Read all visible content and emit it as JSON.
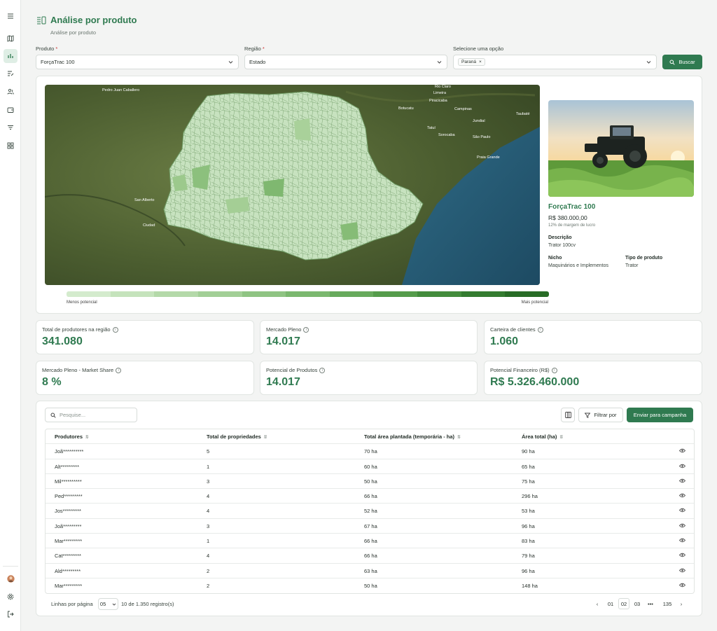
{
  "page": {
    "title": "Análise por produto",
    "subtitle": "Análise por produto"
  },
  "filters": {
    "produto_label": "Produto",
    "produto_value": "ForçaTrac 100",
    "regiao_label": "Região",
    "regiao_value": "Estado",
    "opcao_label": "Selecione uma opção",
    "opcao_chip": "Paraná",
    "search_button": "Buscar",
    "required_mark": "*"
  },
  "map": {
    "cities": [
      "Pedro Juan Caballero",
      "Rio Claro",
      "Limeira",
      "Piracicaba",
      "Botucatu",
      "Campinas",
      "Jundiaí",
      "Taubaté",
      "Tatuí",
      "Sorocaba",
      "São Paulo",
      "Praia Grande",
      "San Alberto",
      "Ciudad"
    ],
    "legend_low": "Menos potencial",
    "legend_high": "Mais potencial",
    "legend_colors": [
      "#d4ebcd",
      "#c5e3bc",
      "#b4d9a9",
      "#a2cf96",
      "#8fc483",
      "#7bb86f",
      "#67aa5c",
      "#559c4b",
      "#438c3c",
      "#347c30",
      "#286c26"
    ]
  },
  "product": {
    "name": "ForçaTrac 100",
    "price": "R$ 380.000,00",
    "margin": "12% de margem de lucro",
    "desc_label": "Descrição",
    "desc_value": "Trator 100cv",
    "nicho_label": "Nicho",
    "nicho_value": "Maquinários e Implementos",
    "tipo_label": "Tipo de produto",
    "tipo_value": "Trator"
  },
  "stats": [
    {
      "label": "Total de produtores na região",
      "value": "341.080"
    },
    {
      "label": "Mercado Pleno",
      "value": "14.017"
    },
    {
      "label": "Carteira de clientes",
      "value": "1.060"
    },
    {
      "label": "Mercado Pleno - Market Share",
      "value": "8 %"
    },
    {
      "label": "Potencial de Produtos",
      "value": "14.017"
    },
    {
      "label": "Potencial Financeiro (R$)",
      "value": "R$ 5.326.460.000"
    }
  ],
  "table": {
    "search_placeholder": "Pesquise...",
    "filter_button": "Filtrar por",
    "campaign_button": "Enviar para campanha",
    "headers": [
      "Produtores",
      "Total de propriedades",
      "Total área plantada (temporária - ha)",
      "Área total (ha)"
    ],
    "rows": [
      [
        "Joã**********",
        "5",
        "70 ha",
        "90 ha"
      ],
      [
        "Alt*********",
        "1",
        "60 ha",
        "65 ha"
      ],
      [
        "Mil**********",
        "3",
        "50 ha",
        "75 ha"
      ],
      [
        "Ped*********",
        "4",
        "66 ha",
        "296 ha"
      ],
      [
        "Jos*********",
        "4",
        "52 ha",
        "53 ha"
      ],
      [
        "Joã*********",
        "3",
        "67 ha",
        "96 ha"
      ],
      [
        "Mar*********",
        "1",
        "66 ha",
        "83 ha"
      ],
      [
        "Cat*********",
        "4",
        "66 ha",
        "79 ha"
      ],
      [
        "Ald*********",
        "2",
        "63 ha",
        "96 ha"
      ],
      [
        "Mar*********",
        "2",
        "50 ha",
        "148 ha"
      ]
    ]
  },
  "pagination": {
    "rows_label": "Linhas por página",
    "rows_value": "05",
    "count_text": "10 de 1.350 registro(s)",
    "pages": [
      "01",
      "02",
      "03",
      "•••",
      "135"
    ],
    "current": "02"
  },
  "colors": {
    "accent": "#2f7a50",
    "accent_light": "#dfeee5"
  }
}
